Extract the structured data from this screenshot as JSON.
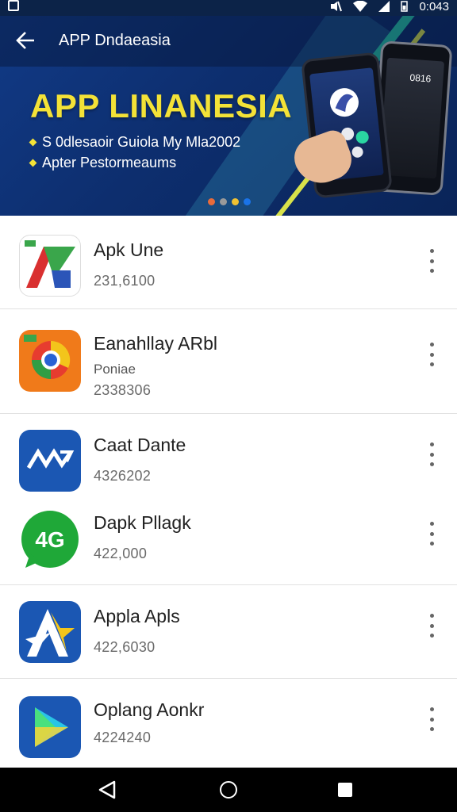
{
  "status_bar": {
    "time": "0:043"
  },
  "header": {
    "title": "APP Dndaeasia"
  },
  "banner": {
    "heading": "APP LINANESIA",
    "bullets": [
      "S 0dlesaoir Guiola My Mla2002",
      "Apter Pestormeaums"
    ],
    "phone_back_clock": "0816",
    "pager": {
      "count": 4,
      "active_index": 0,
      "colors": [
        "#e86b3b",
        "#9a9a9a",
        "#f1c232",
        "#1a73e8"
      ]
    }
  },
  "apps": [
    {
      "name": "Apk Une",
      "subtitle": "",
      "count": "231,6100",
      "icon": "apk-logo-icon"
    },
    {
      "name": "Eanahllay ARbl",
      "subtitle": "Poniae",
      "count": "2338306",
      "icon": "chrome-like-icon"
    },
    {
      "name": "Caat Dante",
      "subtitle": "",
      "count": "4326202",
      "icon": "blue-arrows-icon"
    },
    {
      "name": "Dapk Pllagk",
      "subtitle": "",
      "count": "422,000",
      "icon": "4g-chat-icon"
    },
    {
      "name": "Appla Apls",
      "subtitle": "",
      "count": "422,6030",
      "icon": "star-a-icon"
    },
    {
      "name": "Oplang Aonkr",
      "subtitle": "",
      "count": "4224240",
      "icon": "play-triangle-icon"
    }
  ],
  "colors": {
    "accent_yellow": "#f3e237",
    "banner_blue": "#0d2e6e"
  }
}
